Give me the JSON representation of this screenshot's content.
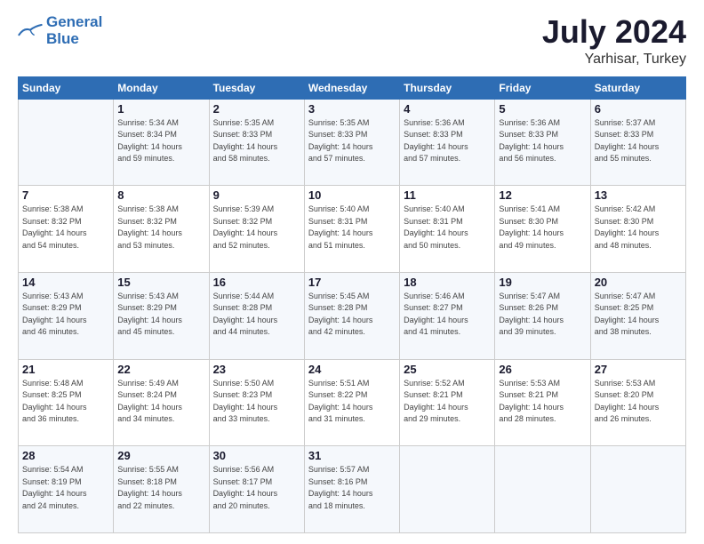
{
  "header": {
    "logo_line1": "General",
    "logo_line2": "Blue",
    "month": "July 2024",
    "location": "Yarhisar, Turkey"
  },
  "days_of_week": [
    "Sunday",
    "Monday",
    "Tuesday",
    "Wednesday",
    "Thursday",
    "Friday",
    "Saturday"
  ],
  "weeks": [
    [
      {
        "day": "",
        "info": ""
      },
      {
        "day": "1",
        "info": "Sunrise: 5:34 AM\nSunset: 8:34 PM\nDaylight: 14 hours\nand 59 minutes."
      },
      {
        "day": "2",
        "info": "Sunrise: 5:35 AM\nSunset: 8:33 PM\nDaylight: 14 hours\nand 58 minutes."
      },
      {
        "day": "3",
        "info": "Sunrise: 5:35 AM\nSunset: 8:33 PM\nDaylight: 14 hours\nand 57 minutes."
      },
      {
        "day": "4",
        "info": "Sunrise: 5:36 AM\nSunset: 8:33 PM\nDaylight: 14 hours\nand 57 minutes."
      },
      {
        "day": "5",
        "info": "Sunrise: 5:36 AM\nSunset: 8:33 PM\nDaylight: 14 hours\nand 56 minutes."
      },
      {
        "day": "6",
        "info": "Sunrise: 5:37 AM\nSunset: 8:33 PM\nDaylight: 14 hours\nand 55 minutes."
      }
    ],
    [
      {
        "day": "7",
        "info": "Sunrise: 5:38 AM\nSunset: 8:32 PM\nDaylight: 14 hours\nand 54 minutes."
      },
      {
        "day": "8",
        "info": "Sunrise: 5:38 AM\nSunset: 8:32 PM\nDaylight: 14 hours\nand 53 minutes."
      },
      {
        "day": "9",
        "info": "Sunrise: 5:39 AM\nSunset: 8:32 PM\nDaylight: 14 hours\nand 52 minutes."
      },
      {
        "day": "10",
        "info": "Sunrise: 5:40 AM\nSunset: 8:31 PM\nDaylight: 14 hours\nand 51 minutes."
      },
      {
        "day": "11",
        "info": "Sunrise: 5:40 AM\nSunset: 8:31 PM\nDaylight: 14 hours\nand 50 minutes."
      },
      {
        "day": "12",
        "info": "Sunrise: 5:41 AM\nSunset: 8:30 PM\nDaylight: 14 hours\nand 49 minutes."
      },
      {
        "day": "13",
        "info": "Sunrise: 5:42 AM\nSunset: 8:30 PM\nDaylight: 14 hours\nand 48 minutes."
      }
    ],
    [
      {
        "day": "14",
        "info": "Sunrise: 5:43 AM\nSunset: 8:29 PM\nDaylight: 14 hours\nand 46 minutes."
      },
      {
        "day": "15",
        "info": "Sunrise: 5:43 AM\nSunset: 8:29 PM\nDaylight: 14 hours\nand 45 minutes."
      },
      {
        "day": "16",
        "info": "Sunrise: 5:44 AM\nSunset: 8:28 PM\nDaylight: 14 hours\nand 44 minutes."
      },
      {
        "day": "17",
        "info": "Sunrise: 5:45 AM\nSunset: 8:28 PM\nDaylight: 14 hours\nand 42 minutes."
      },
      {
        "day": "18",
        "info": "Sunrise: 5:46 AM\nSunset: 8:27 PM\nDaylight: 14 hours\nand 41 minutes."
      },
      {
        "day": "19",
        "info": "Sunrise: 5:47 AM\nSunset: 8:26 PM\nDaylight: 14 hours\nand 39 minutes."
      },
      {
        "day": "20",
        "info": "Sunrise: 5:47 AM\nSunset: 8:25 PM\nDaylight: 14 hours\nand 38 minutes."
      }
    ],
    [
      {
        "day": "21",
        "info": "Sunrise: 5:48 AM\nSunset: 8:25 PM\nDaylight: 14 hours\nand 36 minutes."
      },
      {
        "day": "22",
        "info": "Sunrise: 5:49 AM\nSunset: 8:24 PM\nDaylight: 14 hours\nand 34 minutes."
      },
      {
        "day": "23",
        "info": "Sunrise: 5:50 AM\nSunset: 8:23 PM\nDaylight: 14 hours\nand 33 minutes."
      },
      {
        "day": "24",
        "info": "Sunrise: 5:51 AM\nSunset: 8:22 PM\nDaylight: 14 hours\nand 31 minutes."
      },
      {
        "day": "25",
        "info": "Sunrise: 5:52 AM\nSunset: 8:21 PM\nDaylight: 14 hours\nand 29 minutes."
      },
      {
        "day": "26",
        "info": "Sunrise: 5:53 AM\nSunset: 8:21 PM\nDaylight: 14 hours\nand 28 minutes."
      },
      {
        "day": "27",
        "info": "Sunrise: 5:53 AM\nSunset: 8:20 PM\nDaylight: 14 hours\nand 26 minutes."
      }
    ],
    [
      {
        "day": "28",
        "info": "Sunrise: 5:54 AM\nSunset: 8:19 PM\nDaylight: 14 hours\nand 24 minutes."
      },
      {
        "day": "29",
        "info": "Sunrise: 5:55 AM\nSunset: 8:18 PM\nDaylight: 14 hours\nand 22 minutes."
      },
      {
        "day": "30",
        "info": "Sunrise: 5:56 AM\nSunset: 8:17 PM\nDaylight: 14 hours\nand 20 minutes."
      },
      {
        "day": "31",
        "info": "Sunrise: 5:57 AM\nSunset: 8:16 PM\nDaylight: 14 hours\nand 18 minutes."
      },
      {
        "day": "",
        "info": ""
      },
      {
        "day": "",
        "info": ""
      },
      {
        "day": "",
        "info": ""
      }
    ]
  ]
}
